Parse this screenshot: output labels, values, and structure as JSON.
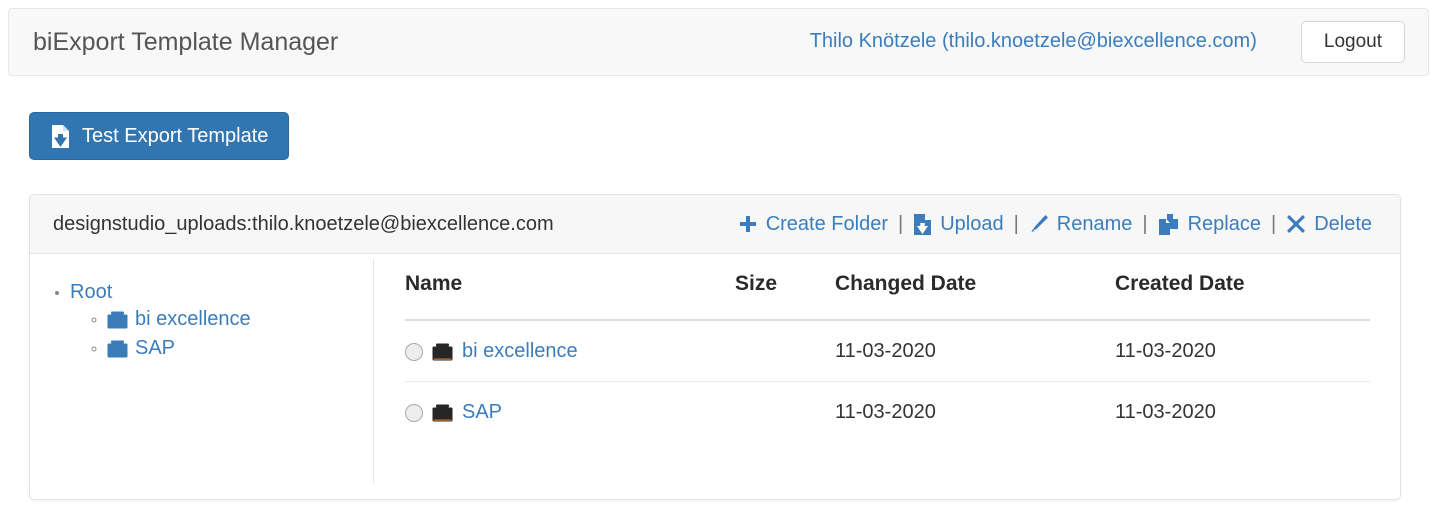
{
  "navbar": {
    "brand": "biExport Template Manager",
    "user": "Thilo Knötzele (thilo.knoetzele@biexcellence.com)",
    "logout_label": "Logout"
  },
  "toolbar": {
    "test_export_label": "Test Export Template"
  },
  "panel": {
    "path": "designstudio_uploads:thilo.knoetzele@biexcellence.com",
    "actions": [
      {
        "label": "Create Folder",
        "icon": "plus-icon"
      },
      {
        "label": "Upload",
        "icon": "upload-file-icon"
      },
      {
        "label": "Rename",
        "icon": "pencil-icon"
      },
      {
        "label": "Replace",
        "icon": "copy-files-icon"
      },
      {
        "label": "Delete",
        "icon": "cross-icon"
      }
    ],
    "separator": "|"
  },
  "tree": {
    "root_label": "Root",
    "children": [
      {
        "label": "bi excellence"
      },
      {
        "label": "SAP"
      }
    ]
  },
  "table": {
    "headers": [
      "Name",
      "Size",
      "Changed Date",
      "Created Date"
    ],
    "rows": [
      {
        "name": "bi excellence",
        "size": "",
        "changed": "11-03-2020",
        "created": "11-03-2020"
      },
      {
        "name": "SAP",
        "size": "",
        "changed": "11-03-2020",
        "created": "11-03-2020"
      }
    ]
  },
  "colors": {
    "link": "#3b7dbc",
    "primary_button": "#3276b1",
    "navbar_bg": "#f8f8f8",
    "panel_head_bg": "#f7f7f7",
    "tree_folder": "#3a7cb8",
    "table_folder": "#262626"
  }
}
